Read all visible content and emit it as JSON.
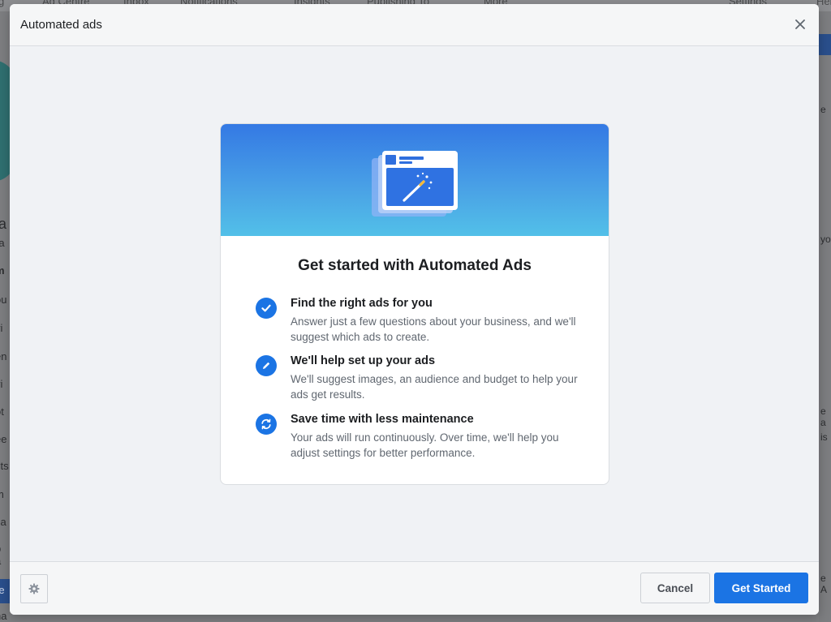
{
  "background": {
    "nav_items": [
      "Ad Centre",
      "Inbox",
      "Notifications",
      "Insights",
      "Publishing To",
      "More",
      "Settings",
      "Help"
    ],
    "notifications_badge": "",
    "left_fragments": [
      "a",
      "ra",
      "m",
      "ou",
      "vi",
      "en",
      "vi",
      "ot",
      "ee",
      "sts",
      "m",
      "ca",
      "p a",
      "re",
      "na"
    ],
    "right_fragments": [
      "e",
      "you",
      "e a",
      "is",
      "e A"
    ]
  },
  "modal": {
    "title": "Automated ads",
    "close_glyph": "✕",
    "card": {
      "heading": "Get started with Automated Ads",
      "features": [
        {
          "icon": "check-icon",
          "title": "Find the right ads for you",
          "description": "Answer just a few questions about your business, and we'll suggest which ads to create."
        },
        {
          "icon": "pencil-icon",
          "title": "We'll help set up your ads",
          "description": "We'll suggest images, an audience and budget to help your ads get results."
        },
        {
          "icon": "refresh-icon",
          "title": "Save time with less maintenance",
          "description": "Your ads will run continuously. Over time, we'll help you adjust settings for better performance."
        }
      ]
    },
    "footer": {
      "settings_icon": "gear-icon",
      "cancel_label": "Cancel",
      "primary_label": "Get Started"
    }
  },
  "colors": {
    "primary": "#1b74e4",
    "banner_top": "#3479e4",
    "banner_bottom": "#52c0e8",
    "overlay": "#7f8083"
  }
}
